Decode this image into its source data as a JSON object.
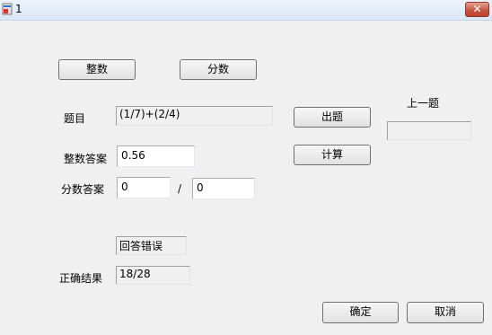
{
  "window": {
    "title": "1",
    "close_glyph": "✕"
  },
  "buttons": {
    "integer": "整数",
    "fraction": "分数",
    "generate": "出题",
    "calculate": "计算",
    "ok": "确定",
    "cancel": "取消"
  },
  "question": {
    "label": "题目",
    "value": "(1/7)+(2/4)"
  },
  "previous": {
    "label": "上一题",
    "value": ""
  },
  "integer_answer": {
    "label": "整数答案",
    "value": "0.56"
  },
  "fraction_answer": {
    "label": "分数答案",
    "numerator": "0",
    "separator": "/",
    "denominator": "0"
  },
  "feedback": {
    "value": "回答错误"
  },
  "correct_result": {
    "label": "正确结果",
    "value": "18/28"
  },
  "icons": {
    "app": "app-icon",
    "close": "close-icon"
  }
}
